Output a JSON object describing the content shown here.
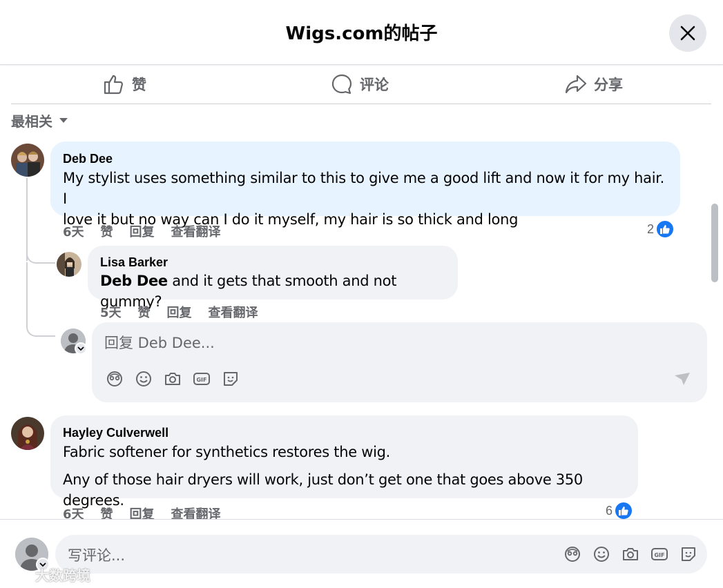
{
  "header": {
    "title": "Wigs.com的帖子"
  },
  "actions": {
    "like": "赞",
    "comment": "评论",
    "share": "分享"
  },
  "sort": {
    "label": "最相关"
  },
  "comments": [
    {
      "author": "Deb Dee",
      "text_line1": "My stylist uses something similar to this to give me a good lift and now it for my hair. I",
      "text_line2": "love it but no way can I do it myself, my hair is so thick and long",
      "time": "6天",
      "like": "赞",
      "reply": "回复",
      "translate": "查看翻译",
      "likes": "2"
    },
    {
      "author": "Lisa Barker",
      "mention": "Deb Dee",
      "text": " and it gets that smooth and not gummy?",
      "time": "5天",
      "like": "赞",
      "reply": "回复",
      "translate": "查看翻译"
    },
    {
      "author": "Hayley Culverwell",
      "text_line1": "Fabric softener for synthetics restores the wig.",
      "text_line2": "Any of those hair dryers will work, just don’t get one that goes above 350 degrees.",
      "time": "6天",
      "like": "赞",
      "reply": "回复",
      "translate": "查看翻译",
      "likes": "6"
    }
  ],
  "reply_box": {
    "placeholder": "回复 Deb Dee..."
  },
  "composer": {
    "placeholder": "写评论..."
  },
  "watermark": "大数跨境",
  "colors": {
    "accent": "#1877f2",
    "bubble": "#f0f2f5",
    "highlight_bubble": "#e7f3ff",
    "muted": "#65676b"
  }
}
